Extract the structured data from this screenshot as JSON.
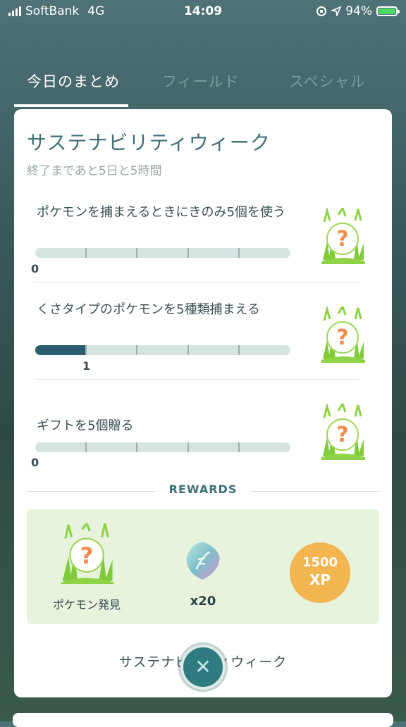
{
  "status_bar": {
    "carrier": "SoftBank",
    "network": "4G",
    "time": "14:09",
    "battery": "94%"
  },
  "tabs": [
    {
      "label": "今日のまとめ",
      "active": true
    },
    {
      "label": "フィールド",
      "active": false
    },
    {
      "label": "スペシャル",
      "active": false
    }
  ],
  "research": {
    "title": "サステナビリティウィーク",
    "subtitle": "終了まであと5日と5時間",
    "tasks": [
      {
        "text": "ポケモンを捕まえるときにきのみ5個を使う",
        "progress": 0,
        "target": 5,
        "count_label": "0",
        "reward_icon": "mystery-pokemon-encounter-icon"
      },
      {
        "text": "くさタイプのポケモンを5種類捕まえる",
        "progress": 1,
        "target": 5,
        "count_label": "1",
        "reward_icon": "mystery-pokemon-encounter-icon"
      },
      {
        "text": "ギフトを5個贈る",
        "progress": 0,
        "target": 5,
        "count_label": "0",
        "reward_icon": "mystery-pokemon-encounter-icon"
      }
    ],
    "rewards_heading": "REWARDS",
    "rewards": [
      {
        "label": "ポケモン発見",
        "icon": "mystery-pokemon-encounter-icon"
      },
      {
        "label": "x20",
        "icon": "stardust-icon"
      },
      {
        "xp_value": "1500",
        "xp_unit": "XP",
        "icon": "xp-badge-icon"
      }
    ],
    "footer": "サステナビリティウィーク",
    "close_icon": "close-icon"
  },
  "colors": {
    "accent": "#3f6f78",
    "progress": "#2c5c70",
    "bar_bg": "#d6e4e1",
    "rewards_bg": "#e8f3de",
    "xp": "#f2b550",
    "close_btn": "#2f7c80"
  }
}
